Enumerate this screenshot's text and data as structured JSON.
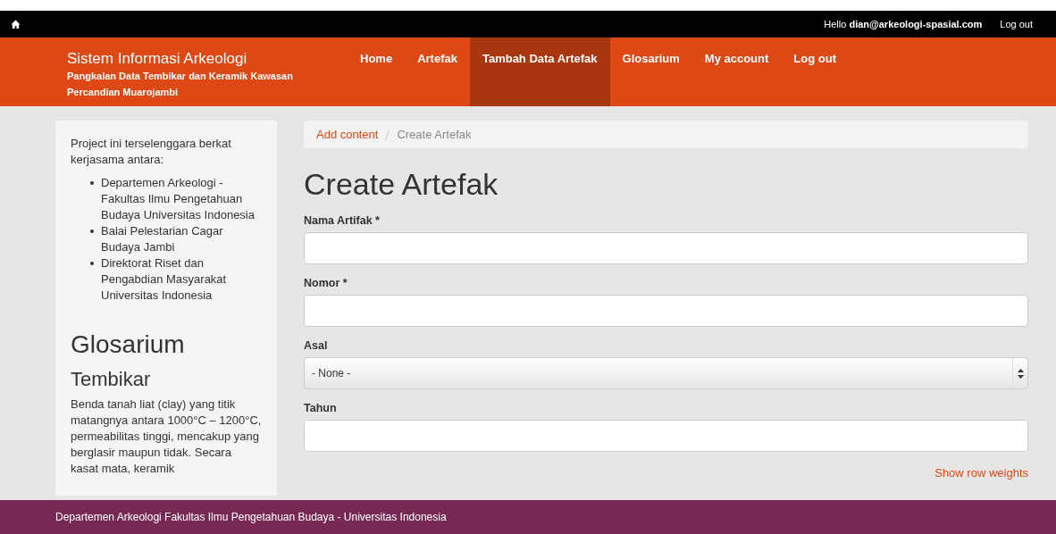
{
  "topbar": {
    "greeting": "Hello",
    "user": "dian@arkeologi-spasial.com",
    "logout": "Log out"
  },
  "header": {
    "title": "Sistem Informasi Arkeologi",
    "subtitle": "Pangkalan Data Tembikar dan Keramik Kawasan Percandian Muarojambi"
  },
  "nav": [
    {
      "label": "Home",
      "selected": false
    },
    {
      "label": "Artefak",
      "selected": false
    },
    {
      "label": "Tambah Data Artefak",
      "selected": true
    },
    {
      "label": "Glosarium",
      "selected": false
    },
    {
      "label": "My account",
      "selected": false
    },
    {
      "label": "Log out",
      "selected": false
    }
  ],
  "sidebar": {
    "intro": "Project ini terselenggara berkat kerjasama antara:",
    "partners": [
      "Departemen Arkeologi - Fakultas Ilmu Pengetahuan Budaya Universitas Indonesia",
      "Balai Pelestarian Cagar Budaya Jambi",
      "Direktorat Riset dan Pengabdian Masyarakat Universitas Indonesia"
    ],
    "heading": "Glosarium",
    "term": "Tembikar",
    "definition": "Benda tanah liat (clay) yang titik matangnya antara 1000°C – 1200°C, permeabilitas tinggi, mencakup yang berglasir maupun tidak. Secara kasat mata, keramik"
  },
  "breadcrumb": [
    {
      "label": "Add content",
      "kind": "link"
    },
    {
      "label": "Create Artefak",
      "kind": "current"
    }
  ],
  "page_title": "Create Artefak",
  "fields": [
    {
      "label": "Nama Artifak *",
      "kind": "text"
    },
    {
      "label": "Nomor *",
      "kind": "text"
    },
    {
      "label": "Asal",
      "kind": "select",
      "value": "- None -"
    },
    {
      "label": "Tahun",
      "kind": "text"
    }
  ],
  "row_weights_link": "Show row weights",
  "footer": "Departemen Arkeologi Fakultas Ilmu Pengetahuan Budaya - Universitas Indonesia"
}
